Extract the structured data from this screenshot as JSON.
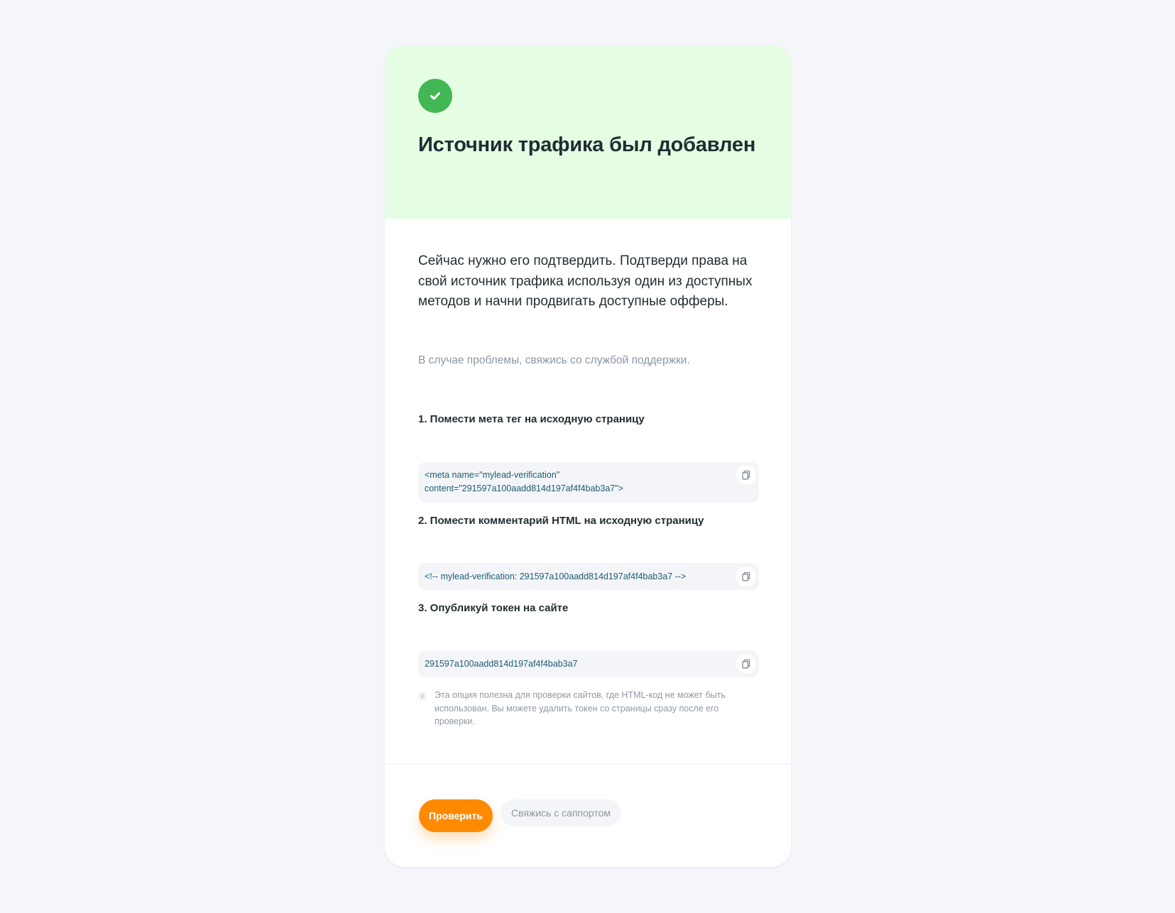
{
  "header": {
    "title": "Источник трафика был добавлен",
    "accent_color": "#43b754",
    "background_color": "#e5fde2",
    "icon": "check-icon"
  },
  "intro": {
    "text": "Сейчас нужно его подтвердить. Подтверди права на свой источник трафика используя один из доступных методов и начни продвигать доступные офферы.",
    "support_note": "В случае проблемы, свяжись со службой поддержки."
  },
  "methods": [
    {
      "title": "1. Помести мета тег на исходную страницу",
      "code": "<meta name=\"mylead-verification\"\ncontent=\"291597a100aadd814d197af4f4bab3a7\">",
      "copy_icon": "copy-icon"
    },
    {
      "title": "2. Помести комментарий HTML на исходную страницу",
      "code": "<!-- mylead-verification: 291597a100aadd814d197af4f4bab3a7 -->",
      "copy_icon": "copy-icon"
    },
    {
      "title": "3. Опубликуй токен на сайте",
      "code": "291597a100aadd814d197af4f4bab3a7",
      "copy_icon": "copy-icon"
    }
  ],
  "hint": {
    "icon": "info-icon",
    "text": "Эта опция полезна для проверки сайтов, где HTML-код не может быть использован. Вы можете удалить токен со страницы сразу после его проверки."
  },
  "actions": {
    "verify_label": "Проверить",
    "verify_color": "#ff8a00",
    "support_label": "Свяжись с саппортом"
  }
}
